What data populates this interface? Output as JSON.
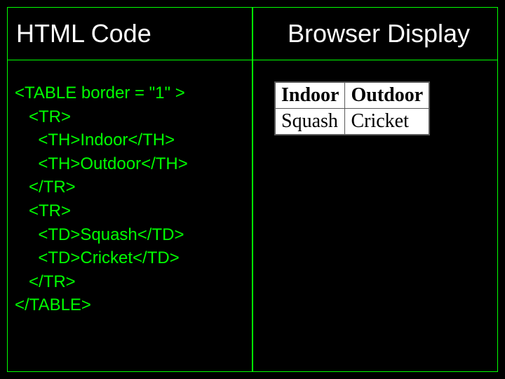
{
  "left": {
    "title": "HTML Code",
    "code": "<TABLE border = \"1\" >\n   <TR>\n     <TH>Indoor</TH>\n     <TH>Outdoor</TH>\n   </TR>\n   <TR>\n     <TD>Squash</TD>\n     <TD>Cricket</TD>\n   </TR>\n</TABLE>"
  },
  "right": {
    "title": "Browser Display",
    "table": {
      "headers": [
        "Indoor",
        "Outdoor"
      ],
      "row": [
        "Squash",
        "Cricket"
      ]
    }
  }
}
